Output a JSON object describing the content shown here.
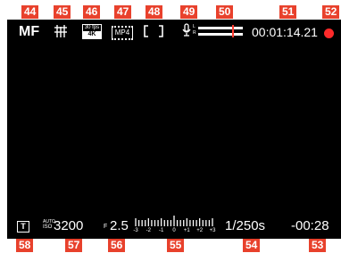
{
  "callouts": {
    "c44": "44",
    "c45": "45",
    "c46": "46",
    "c47": "47",
    "c48": "48",
    "c49": "49",
    "c50": "50",
    "c51": "51",
    "c52": "52",
    "c53": "53",
    "c54": "54",
    "c55": "55",
    "c56": "56",
    "c57": "57",
    "c58": "58"
  },
  "top": {
    "focus_mode": "MF",
    "video_format_top": "30 fps",
    "video_format_bottom": "4K",
    "file_format": "MP4",
    "mic_label_top": "L",
    "mic_label_bottom": "R",
    "timecode": "00:01:14.21"
  },
  "bottom": {
    "iso_auto": "AUTO",
    "iso_label": "ISO",
    "iso_value": "3200",
    "aperture_prefix": "F",
    "aperture_value": "2.5",
    "exposure_scale_labels": [
      "-3",
      "-2",
      "-1",
      "0",
      "+1",
      "+2",
      "+3"
    ],
    "shutter_speed": "1/250s",
    "remaining_time": "-00:28"
  },
  "colors": {
    "callout_bg": "#e8412c",
    "recording_dot": "#ff2a2a",
    "mic_peak": "#ff3b30",
    "frame_bg": "#000000",
    "text": "#ffffff"
  },
  "icons": {
    "focus_grid": "grid-lines-icon",
    "video_format": "video-format-icon",
    "file_format": "film-strip-icon",
    "metering": "spot-metering-icon",
    "mic": "microphone-icon",
    "record": "record-dot-icon",
    "shooting_mode": "t-mode-icon"
  }
}
